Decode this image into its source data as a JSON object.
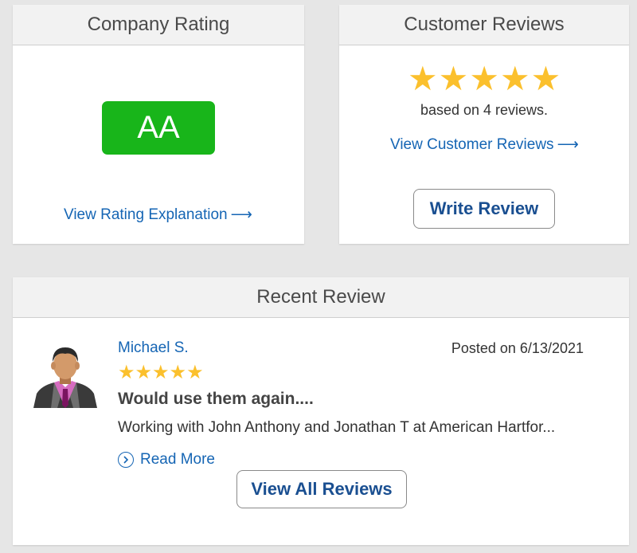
{
  "company_rating": {
    "title": "Company Rating",
    "grade": "AA",
    "grade_color": "#18b51a",
    "link_label": "View Rating Explanation"
  },
  "customer_reviews": {
    "title": "Customer Reviews",
    "stars": 5,
    "star_color": "#fbc02d",
    "review_count_text": "based on 4 reviews.",
    "link_label": "View Customer Reviews",
    "write_button_label": "Write Review"
  },
  "recent_review": {
    "title": "Recent Review",
    "reviewer_name": "Michael S.",
    "posted_on": "Posted on 6/13/2021",
    "stars": 5,
    "review_title": "Would use them again....",
    "snippet": "Working with John Anthony and Jonathan T at American Hartfor...",
    "read_more_label": "Read More",
    "view_all_label": "View All Reviews"
  },
  "icons": {
    "arrow": "arrow-right-icon",
    "star": "star-icon",
    "read_more": "chevron-right-circle-icon",
    "avatar": "person-avatar-icon"
  }
}
